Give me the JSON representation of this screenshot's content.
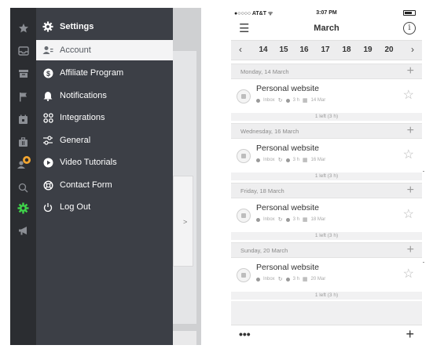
{
  "left_app": {
    "rail_icons": [
      "star-icon",
      "inbox-icon",
      "archive-icon",
      "flag-icon",
      "calendar-icon",
      "briefcase-icon",
      "users-icon",
      "search-icon",
      "gear-icon",
      "megaphone-icon"
    ],
    "menu": {
      "header": "Settings",
      "items": [
        {
          "label": "Account",
          "icon": "user-settings-icon",
          "active": true
        },
        {
          "label": "Affiliate Program",
          "icon": "dollar-icon",
          "active": false
        },
        {
          "label": "Notifications",
          "icon": "bell-icon",
          "active": false
        },
        {
          "label": "Integrations",
          "icon": "integrations-icon",
          "active": false
        },
        {
          "label": "General",
          "icon": "sliders-icon",
          "active": false
        },
        {
          "label": "Video Tutorials",
          "icon": "play-icon",
          "active": false
        },
        {
          "label": "Contact Form",
          "icon": "lifebuoy-icon",
          "active": false
        },
        {
          "label": "Log Out",
          "icon": "power-icon",
          "active": false
        }
      ]
    },
    "background_fragment": ">"
  },
  "phone": {
    "status": {
      "carrier": "●○○○○ AT&T ᯤ",
      "time": "3:07 PM"
    },
    "nav": {
      "menu_icon": "☰",
      "title": "March",
      "info_icon": "i"
    },
    "date_strip": {
      "prev": "‹",
      "next": "›",
      "days": [
        "14",
        "15",
        "16",
        "17",
        "18",
        "19",
        "20"
      ]
    },
    "sections": [
      {
        "header": "Monday, 14 March",
        "task": {
          "title": "Personal website",
          "folder": "Inbox",
          "duration": "3 h",
          "date": "14 Mar"
        },
        "left": "1 left (3 h)"
      },
      {
        "header": "Wednesday, 16 March",
        "task": {
          "title": "Personal website",
          "folder": "Inbox",
          "duration": "3 h",
          "date": "16 Mar"
        },
        "left": "1 left (3 h)"
      },
      {
        "header": "Friday, 18 March",
        "task": {
          "title": "Personal website",
          "folder": "Inbox",
          "duration": "3 h",
          "date": "18 Mar"
        },
        "left": "1 left (3 h)"
      },
      {
        "header": "Sunday, 20 March",
        "task": {
          "title": "Personal website",
          "folder": "Inbox",
          "duration": "3 h",
          "date": "20 Mar"
        },
        "left": "1 left (3 h)"
      }
    ],
    "bottom": {
      "more": "•••",
      "add": "+"
    },
    "section_add": "+",
    "star": "☆"
  }
}
